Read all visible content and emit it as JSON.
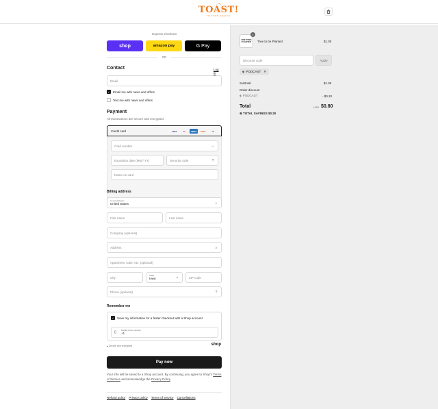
{
  "header": {
    "logo": "TOAST!",
    "tagline": "TO YOUR HEALTH",
    "cart_icon": "shopping-bag-icon"
  },
  "express": {
    "label": "Express checkout",
    "shop": "shop",
    "amazon": "amazon pay",
    "gpay": "G Pay",
    "or": "OR"
  },
  "contact": {
    "heading": "Contact",
    "login": "Log in",
    "email_placeholder": "Email",
    "news_email": "Email me with news and offers",
    "news_text": "Text me with news and offers"
  },
  "payment": {
    "heading": "Payment",
    "subtext": "All transactions are secure and encrypted.",
    "method": "Credit card",
    "card_brands": [
      "VISA",
      "MC",
      "AMEX",
      "DISC",
      "+4"
    ],
    "card_number": "Card number",
    "expiration": "Expiration date (MM / YY)",
    "security": "Security code",
    "name_on_card": "Name on card"
  },
  "billing": {
    "heading": "Billing address",
    "country_label": "Country/Region",
    "country": "United States",
    "first_name": "First name",
    "last_name": "Last name",
    "company": "Company (optional)",
    "address": "Address",
    "apartment": "Apartment, suite, etc. (optional)",
    "city": "City",
    "state_label": "State",
    "state": "Iowa",
    "zip": "ZIP code",
    "phone": "Phone (optional)"
  },
  "remember": {
    "heading": "Remember me",
    "save_info": "Save my information for a faster checkout with a Shop account",
    "phone_label": "Mobile phone number",
    "phone_value": "+1",
    "secure": "Secure and encrypted",
    "shop_logo": "shop"
  },
  "paynow": "Pay now",
  "legal": {
    "text1": "Your info will be saved to a Shop account. By continuing, you agree to Shop's",
    "terms": "Terms of Service",
    "text2": "and acknowledge the",
    "privacy": "Privacy Policy",
    "period": "."
  },
  "footer": [
    "Refund policy",
    "Privacy policy",
    "Terms of service",
    "Cancellations"
  ],
  "summary": {
    "product_name": "Tree to be Planted",
    "product_price": "$1.00",
    "product_qty": "1",
    "thumb_text": "ONE TREE PLANTED",
    "discount_placeholder": "Discount code",
    "apply": "Apply",
    "applied_code": "PODCAST",
    "subtotal_label": "Subtotal",
    "subtotal": "$1.00",
    "order_discount_label": "Order discount",
    "discount_code": "PODCAST",
    "discount_value": "- $0.20",
    "total_label": "Total",
    "currency": "USD",
    "total": "$0.80",
    "savings_label": "TOTAL SAVINGS",
    "savings": "$0.20"
  },
  "colors": {
    "shop": "#5a31f4",
    "amazon": "#ffd814",
    "logo": "#f07a1a"
  }
}
